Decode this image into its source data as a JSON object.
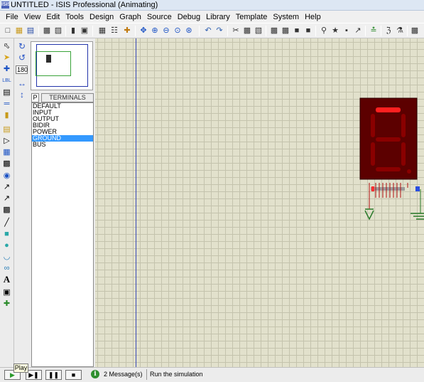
{
  "window": {
    "title": "UNTITLED - ISIS Professional (Animating)",
    "app_icon_text": "ISIS"
  },
  "menu": [
    "File",
    "View",
    "Edit",
    "Tools",
    "Design",
    "Graph",
    "Source",
    "Debug",
    "Library",
    "Template",
    "System",
    "Help"
  ],
  "toolbar": {
    "icons": [
      "new-icon",
      "open-icon",
      "save-icon",
      "import-icon",
      "export-icon",
      "print-icon",
      "area-icon",
      "refresh-icon",
      "grid-icon",
      "origin-icon",
      "pan-icon",
      "zoom-in-icon",
      "zoom-out-icon",
      "zoom-all-icon",
      "zoom-area-icon",
      "undo-icon",
      "redo-icon",
      "cut-icon",
      "copy-icon",
      "paste-icon",
      "block-copy-icon",
      "block-move-icon",
      "block-rotate-icon",
      "block-delete-icon",
      "pick-device-icon",
      "make-device-icon",
      "package-icon",
      "decompose-icon",
      "wire-autorouter-icon",
      "search-tag-icon",
      "property-tool-icon",
      "new-sheet-icon"
    ]
  },
  "left_tools": [
    "selection-mode-icon",
    "component-mode-icon",
    "junction-dot-icon",
    "wire-label-icon",
    "text-script-icon",
    "buses-icon",
    "subcircuit-icon",
    "terminals-icon",
    "device-pins-icon",
    "graph-icon",
    "tape-recorder-icon",
    "generator-icon",
    "voltage-probe-icon",
    "current-probe-icon",
    "virtual-instruments-icon",
    "line-icon",
    "box-icon",
    "circle-icon",
    "arc-icon",
    "path-icon",
    "text-icon",
    "symbol-icon",
    "marker-icon"
  ],
  "side": {
    "angle": "180",
    "p_label": "P",
    "list_title": "TERMINALS"
  },
  "terminals": [
    "DEFAULT",
    "INPUT",
    "OUTPUT",
    "BIDIR",
    "POWER",
    "GROUND",
    "BUS"
  ],
  "selected_terminal": "GROUND",
  "display": {
    "digit": "7",
    "segment_on": "#ff2020",
    "segment_off": "#8a0000",
    "body": "#5c0000"
  },
  "status": {
    "play_tooltip": "Play",
    "info_icon": "i",
    "messages": "2 Message(s)",
    "hint": "Run the simulation"
  },
  "colors": {
    "grid_bg": "#e2e1cc",
    "grid_line": "#c4c3ad",
    "selection": "#3399ff",
    "sheet_edge": "#3a4ab8"
  }
}
